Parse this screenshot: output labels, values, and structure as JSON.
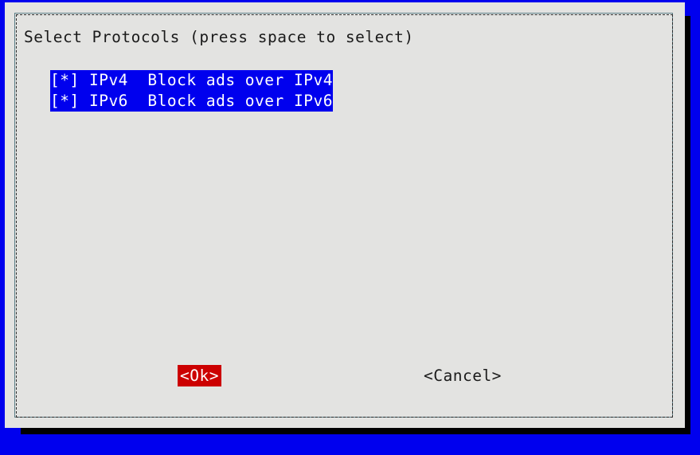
{
  "dialog": {
    "title": "Select Protocols (press space to select)",
    "options": [
      {
        "checkbox": "[*]",
        "tag": "IPv4",
        "description": "Block ads over IPv4",
        "line": "[*] IPv4  Block ads over IPv4",
        "selected": true,
        "highlighted": true
      },
      {
        "checkbox": "[*]",
        "tag": "IPv6",
        "description": "Block ads over IPv6",
        "line": "[*] IPv6  Block ads over IPv6",
        "selected": true,
        "highlighted": true
      }
    ],
    "buttons": {
      "ok_label": "<Ok>",
      "cancel_label": "<Cancel>"
    }
  },
  "colors": {
    "terminal_background": "#0000ee",
    "dialog_background": "#e3e3e1",
    "highlight_background": "#0000ee",
    "highlight_text": "#ffffff",
    "ok_button_background": "#cc0000",
    "ok_button_text": "#ffffff",
    "text": "#1a1a1a",
    "shadow": "#000000",
    "frame_line": "#5c7f88"
  }
}
